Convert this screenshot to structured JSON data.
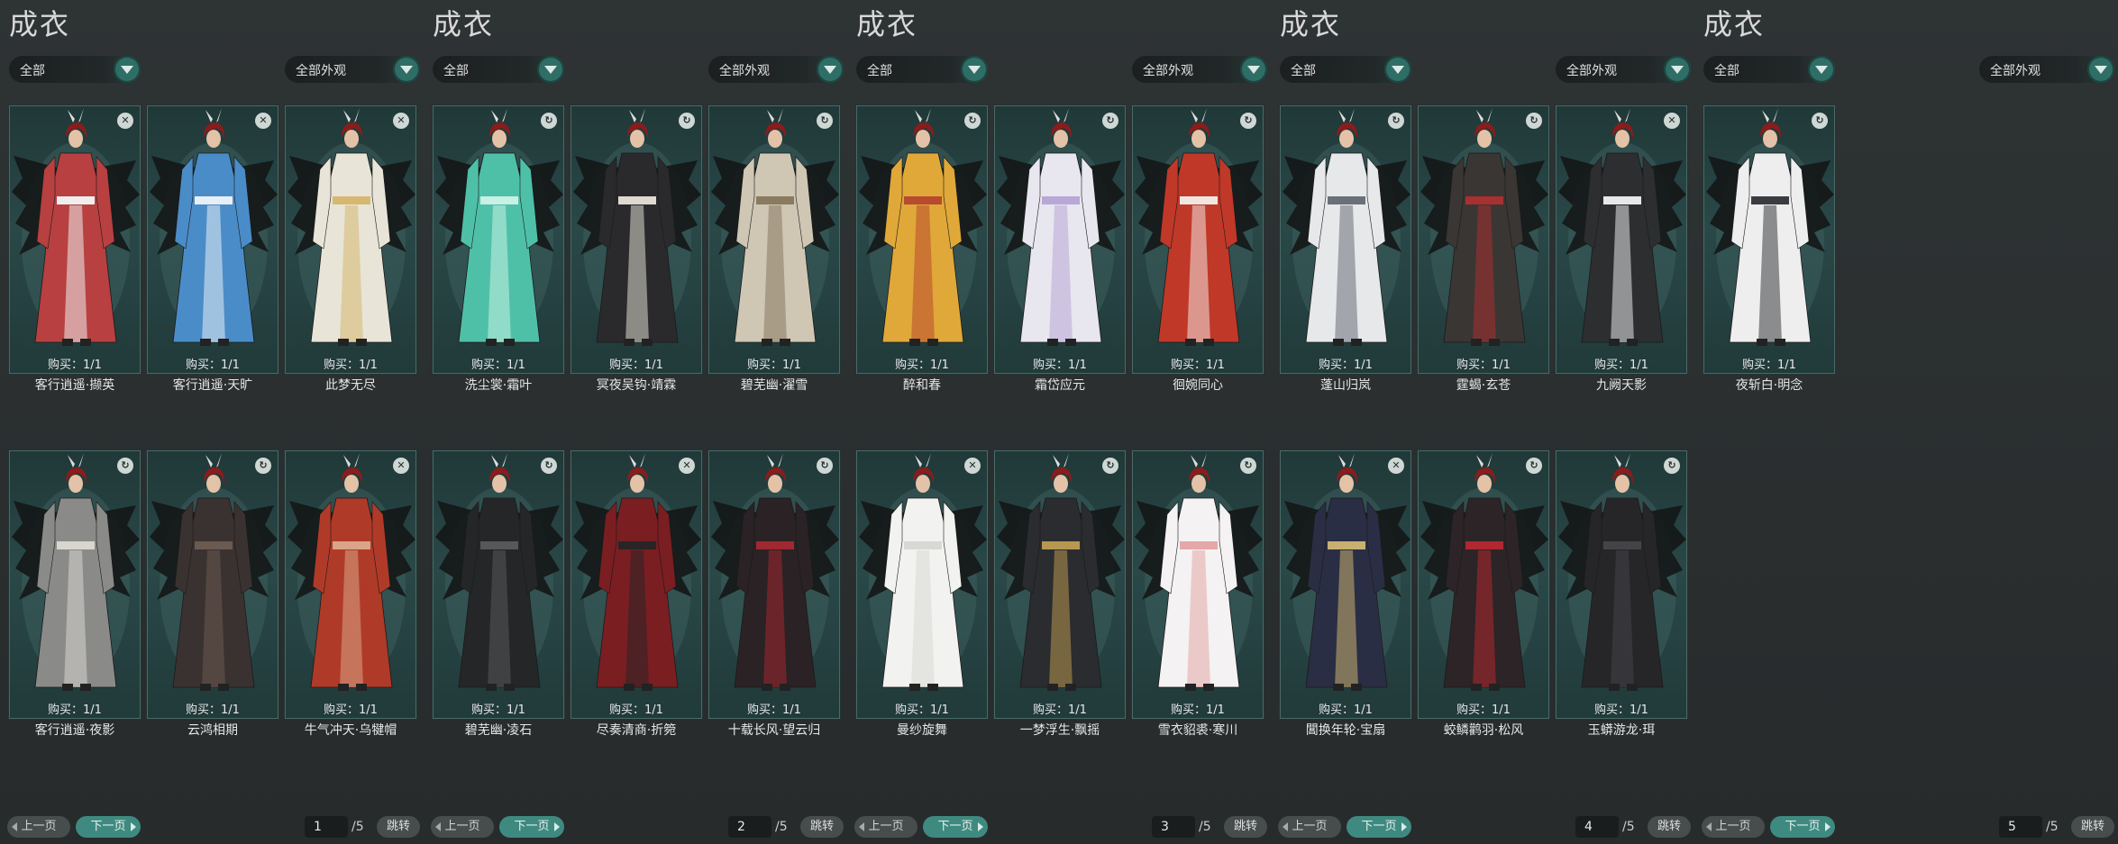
{
  "panels": [
    {
      "title": "成衣",
      "filter_left": "全部",
      "filter_right": "全部外观",
      "prev_label": "上一页",
      "next_label": "下一页",
      "page_current": "1",
      "page_total": "/5",
      "jump_label": "跳转",
      "cards": [
        {
          "name": "客行逍遥·撷英",
          "buy": "购买：1/1",
          "icon": "trash-icon",
          "color": "#b84040",
          "accent": "#eeeeee"
        },
        {
          "name": "客行逍遥·天旷",
          "buy": "购买：1/1",
          "icon": "trash-icon",
          "color": "#4a8cc8",
          "accent": "#e8eef5"
        },
        {
          "name": "此梦无尽",
          "buy": "购买：1/1",
          "icon": "trash-icon",
          "color": "#e8e4d8",
          "accent": "#d6b870"
        },
        {
          "name": "客行逍遥·夜影",
          "buy": "购买：1/1",
          "icon": "swap-icon",
          "color": "#8a8a88",
          "accent": "#d9d6cf"
        },
        {
          "name": "云鸿相期",
          "buy": "购买：1/1",
          "icon": "swap-icon",
          "color": "#3a3230",
          "accent": "#6a5a50"
        },
        {
          "name": "牛气冲天·乌犍帽",
          "buy": "购买：1/1",
          "icon": "trash-icon",
          "color": "#b03a28",
          "accent": "#d9a487"
        }
      ]
    },
    {
      "title": "成衣",
      "filter_left": "全部",
      "filter_right": "全部外观",
      "prev_label": "上一页",
      "next_label": "下一页",
      "page_current": "2",
      "page_total": "/5",
      "jump_label": "跳转",
      "cards": [
        {
          "name": "洗尘裳·霜叶",
          "buy": "购买：1/1",
          "icon": "swap-icon",
          "color": "#4fc0a8",
          "accent": "#c8f0e4"
        },
        {
          "name": "冥夜吴钩·靖霖",
          "buy": "购买：1/1",
          "icon": "swap-icon",
          "color": "#2a2a2c",
          "accent": "#dedad0"
        },
        {
          "name": "碧芜幽·濯雪",
          "buy": "购买：1/1",
          "icon": "swap-icon",
          "color": "#cfc6b4",
          "accent": "#8a7a60"
        },
        {
          "name": "碧芜幽·凌石",
          "buy": "购买：1/1",
          "icon": "swap-icon",
          "color": "#242628",
          "accent": "#56585a"
        },
        {
          "name": "尽奏清商·折箢",
          "buy": "购买：1/1",
          "icon": "trash-icon",
          "color": "#7a1e22",
          "accent": "#2a2426"
        },
        {
          "name": "十载长风·望云归",
          "buy": "购买：1/1",
          "icon": "swap-icon",
          "color": "#2a2224",
          "accent": "#a02830"
        }
      ]
    },
    {
      "title": "成衣",
      "filter_left": "全部",
      "filter_right": "全部外观",
      "prev_label": "上一页",
      "next_label": "下一页",
      "page_current": "3",
      "page_total": "/5",
      "jump_label": "跳转",
      "cards": [
        {
          "name": "醉和春",
          "buy": "购买：1/1",
          "icon": "swap-icon",
          "color": "#e0a838",
          "accent": "#b84a30"
        },
        {
          "name": "霜岱应元",
          "buy": "购买：1/1",
          "icon": "swap-icon",
          "color": "#e8e6ee",
          "accent": "#b8a8d8"
        },
        {
          "name": "徊婉同心",
          "buy": "购买：1/1",
          "icon": "swap-icon",
          "color": "#c03828",
          "accent": "#f0e6e0"
        },
        {
          "name": "曼纱旋舞",
          "buy": "购买：1/1",
          "icon": "trash-icon",
          "color": "#f2f2f0",
          "accent": "#d8d8d4"
        },
        {
          "name": "一梦浮生·飘摇",
          "buy": "购买：1/1",
          "icon": "swap-icon",
          "color": "#2a2c30",
          "accent": "#b89850"
        },
        {
          "name": "雪衣貂裘·寒川",
          "buy": "购买：1/1",
          "icon": "swap-icon",
          "color": "#f4f2f2",
          "accent": "#e4a8a8"
        }
      ]
    },
    {
      "title": "成衣",
      "filter_left": "全部",
      "filter_right": "全部外观",
      "prev_label": "上一页",
      "next_label": "下一页",
      "page_current": "4",
      "page_total": "/5",
      "jump_label": "跳转",
      "cards": [
        {
          "name": "蓬山归岚",
          "buy": "购买：1/1",
          "icon": "swap-icon",
          "color": "#e6e8ea",
          "accent": "#6a7078"
        },
        {
          "name": "霆蝎·玄苍",
          "buy": "购买：1/1",
          "icon": "swap-icon",
          "color": "#3a3634",
          "accent": "#a83030"
        },
        {
          "name": "九阙天影",
          "buy": "购买：1/1",
          "icon": "trash-icon",
          "color": "#2c2e30",
          "accent": "#e8e8e8"
        },
        {
          "name": "閶换年轮·宝扇",
          "buy": "购买：1/1",
          "icon": "trash-icon",
          "color": "#2a2e44",
          "accent": "#c8b070"
        },
        {
          "name": "蛟鳞鹳羽·松风",
          "buy": "购买：1/1",
          "icon": "swap-icon",
          "color": "#2c2426",
          "accent": "#b02830"
        },
        {
          "name": "玉蟒游龙·珥",
          "buy": "购买：1/1",
          "icon": "swap-icon",
          "color": "#262628",
          "accent": "#444448"
        }
      ]
    },
    {
      "title": "成衣",
      "filter_left": "全部",
      "filter_right": "全部外观",
      "prev_label": "上一页",
      "next_label": "下一页",
      "page_current": "5",
      "page_total": "/5",
      "jump_label": "跳转",
      "cards": [
        {
          "name": "夜斩白·明念",
          "buy": "购买：1/1",
          "icon": "swap-icon",
          "color": "#eeeeee",
          "accent": "#3a3c40"
        }
      ]
    }
  ]
}
